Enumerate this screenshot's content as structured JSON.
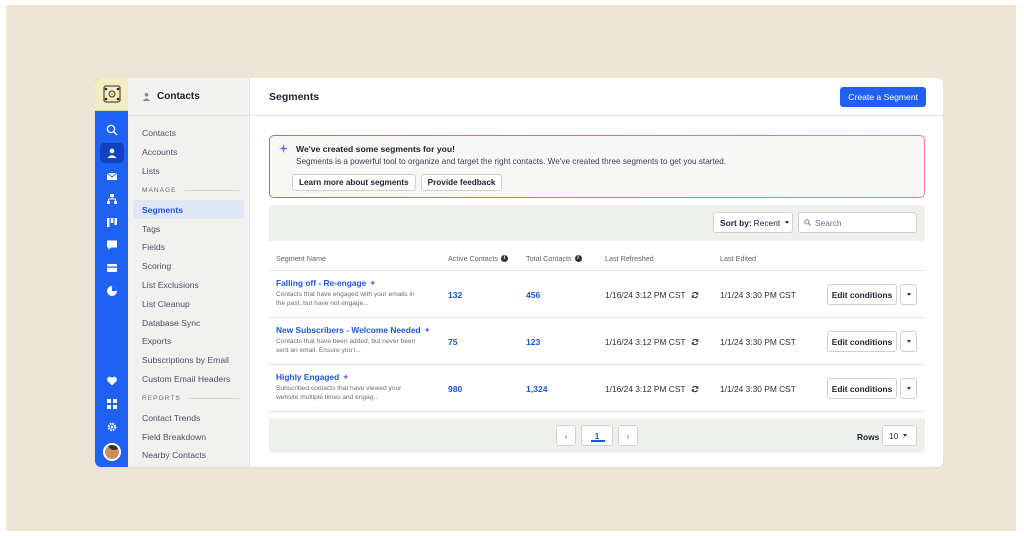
{
  "colors": {
    "primary": "#1f62f3",
    "link": "#1f55e0",
    "sparkle": "#7b5bf0",
    "background": "#ede6d5"
  },
  "rail": {
    "icons": [
      "search-icon",
      "user-icon",
      "mail-icon",
      "sitemap-icon",
      "kanban-icon",
      "chat-icon",
      "card-icon",
      "pie-chart-icon",
      "heart-icon",
      "grid-icon",
      "gear-icon"
    ]
  },
  "menu": {
    "header": "Contacts",
    "items_top": [
      "Contacts",
      "Accounts",
      "Lists"
    ],
    "section_manage": "MANAGE",
    "items_manage": [
      "Segments",
      "Tags",
      "Fields",
      "Scoring",
      "List Exclusions",
      "List Cleanup",
      "Database Sync",
      "Exports",
      "Subscriptions by Email",
      "Custom Email Headers"
    ],
    "section_reports": "REPORTS",
    "items_reports": [
      "Contact Trends",
      "Field Breakdown",
      "Nearby Contacts"
    ]
  },
  "header": {
    "title": "Segments",
    "create_button": "Create a Segment"
  },
  "banner": {
    "title": "We've created some segments for you!",
    "description": "Segments is a powerful tool to organize and target the right contacts. We've created three segments to get you started.",
    "learn_more": "Learn more about segments",
    "feedback": "Provide feedback"
  },
  "toolbar": {
    "sort_label": "Sort by:",
    "sort_value": "Recent",
    "search_placeholder": "Search"
  },
  "table": {
    "columns": [
      "Segment Name",
      "Active Contacts",
      "Total Contacts",
      "Last Refreshed",
      "Last Edited"
    ],
    "edit_label": "Edit conditions",
    "rows": [
      {
        "name": "Falling off - Re-engage",
        "desc": "Contacts that have engaged with your emails in the past, but have not engage...",
        "active": "132",
        "total": "456",
        "refreshed": "1/16/24 3:12 PM CST",
        "edited": "1/1/24 3:30 PM CST"
      },
      {
        "name": "New Subscribers - Welcome Needed",
        "desc": "Contacts that have been added, but never been sent an email. Ensure you'r...",
        "active": "75",
        "total": "123",
        "refreshed": "1/16/24 3:12 PM CST",
        "edited": "1/1/24 3:30 PM CST"
      },
      {
        "name": "Highly Engaged",
        "desc": "Subscribed contacts that have viewed your website multiple times and engag...",
        "active": "980",
        "total": "1,324",
        "refreshed": "1/16/24 3:12 PM CST",
        "edited": "1/1/24 3:30 PM CST"
      }
    ]
  },
  "pagination": {
    "prev": "‹",
    "current": "1",
    "next": "›",
    "rows_label": "Rows",
    "rows_value": "10"
  }
}
